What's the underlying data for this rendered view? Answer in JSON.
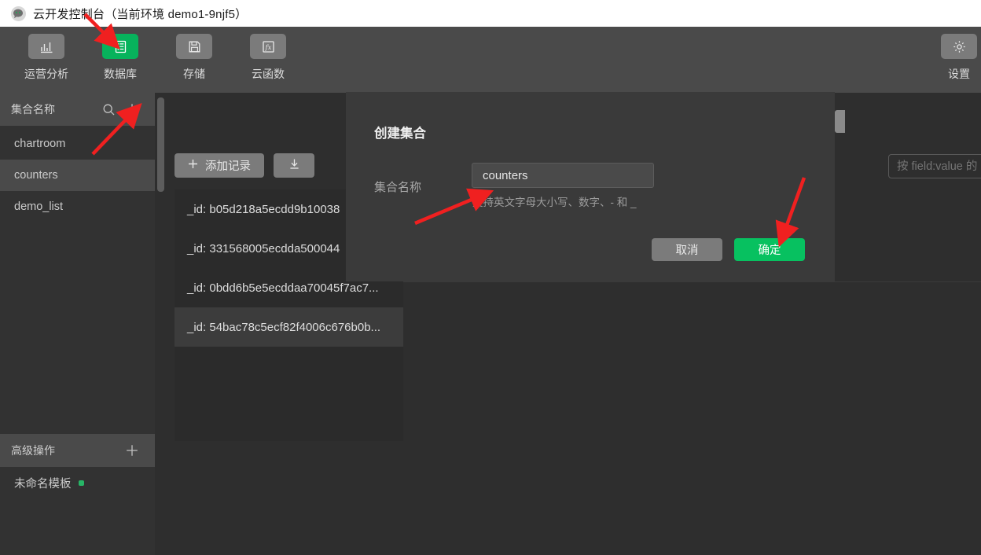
{
  "window": {
    "logo_icon": "wechat-cloud-logo",
    "title": "云开发控制台（当前环境 demo1-9njf5）"
  },
  "topnav": {
    "items": [
      {
        "label": "运营分析",
        "icon": "bar-chart-icon",
        "active": false
      },
      {
        "label": "数据库",
        "icon": "database-icon",
        "active": true
      },
      {
        "label": "存储",
        "icon": "floppy-disk-icon",
        "active": false
      },
      {
        "label": "云函数",
        "icon": "fx-function-icon",
        "active": false
      }
    ],
    "right_items": [
      {
        "label": "设置",
        "icon": "gear-icon"
      }
    ]
  },
  "sidebar": {
    "collections_header": {
      "title": "集合名称",
      "search_icon": "search-icon",
      "add_icon": "plus-icon"
    },
    "collections": [
      {
        "name": "chartroom",
        "selected": false
      },
      {
        "name": "counters",
        "selected": true
      },
      {
        "name": "demo_list",
        "selected": false
      }
    ],
    "advanced_header": {
      "title": "高级操作",
      "add_icon": "plus-icon"
    },
    "templates": [
      {
        "name": "未命名模板",
        "status_dot": "#27b566"
      }
    ]
  },
  "records": {
    "add_button": {
      "label": "添加记录",
      "icon": "plus-icon"
    },
    "import_button": {
      "icon": "download-icon"
    },
    "rows": [
      {
        "text": "_id: b05d218a5ecdd9b10038",
        "highlight": false
      },
      {
        "text": "_id: 331568005ecdda500044",
        "highlight": false
      },
      {
        "text": "_id: 0bdd6b5e5ecddaa70045f7ac7...",
        "highlight": false
      },
      {
        "text": "_id: 54bac78c5ecf82f4006c676b0b...",
        "highlight": true
      }
    ]
  },
  "detail": {
    "filter_placeholder": "按 field:value 的",
    "filter_value": ""
  },
  "modal": {
    "title": "创建集合",
    "field_label": "集合名称",
    "field_value": "counters",
    "field_placeholder": "",
    "hint": "支持英文字母大小写、数字、- 和 _",
    "cancel_label": "取消",
    "confirm_label": "确定"
  },
  "colors": {
    "accent_green": "#07c160",
    "active_tab_green": "#07b35c",
    "titlebar_bg": "#ffffff",
    "nav_bg": "#4a4a4a",
    "sidebar_bg": "#323232",
    "content_bg": "#2e2e2e",
    "modal_bg": "#3a3a3a",
    "button_gray": "#7b7b7b",
    "annotation_red": "#f02020"
  }
}
